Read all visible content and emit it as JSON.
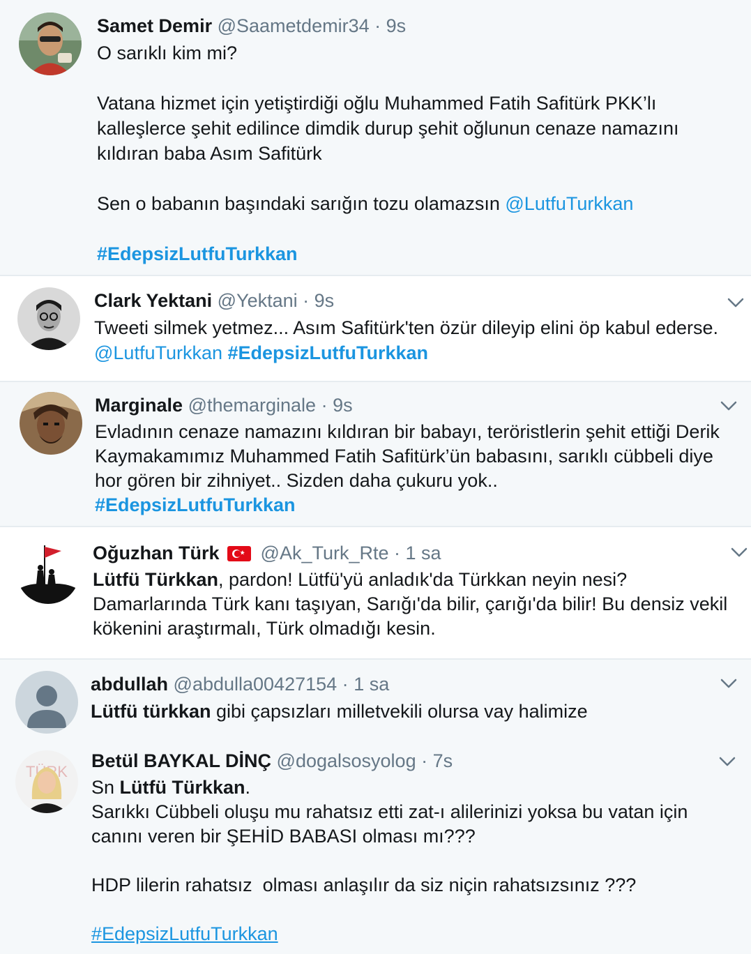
{
  "tweets": [
    {
      "name": "Samet Demir",
      "handle": "@Saametdemir34",
      "time": "9s",
      "line1": "O sarıklı kim mi?",
      "para2": "Vatana hizmet için yetiştirdiği oğlu Muhammed Fatih Safitürk PKK’lı kalleşlerce şehit edilince dimdik durup şehit oğlunun cenaze namazını kıldıran baba Asım Safitürk",
      "para3_text": "Sen o babanın başındaki sarığın tozu olamazsın ",
      "para3_mention": "@LutfuTurkkan",
      "hashtag": "#EdepsizLutfuTurkkan"
    },
    {
      "name": "Clark Yektani",
      "handle": "@Yektani",
      "time": "9s",
      "text": "Tweeti silmek yetmez... Asım Safitürk'ten özür dileyip elini öp kabul ederse.",
      "mention": "@LutfuTurkkan",
      "hashtag": "#EdepsizLutfuTurkkan"
    },
    {
      "name": "Marginale",
      "handle": "@themarginale",
      "time": "9s",
      "text": "Evladının cenaze namazını kıldıran bir babayı, teröristlerin şehit ettiği Derik Kaymakamımız Muhammed Fatih Safitürk’ün babasını, sarıklı cübbeli diye hor gören bir zihniyet.. Sizden daha çukuru yok..",
      "hashtag": "#EdepsizLutfuTurkkan"
    },
    {
      "name": "Oğuzhan Türk",
      "handle": "@Ak_Turk_Rte",
      "time": "1 sa",
      "bold": "Lütfü Türkkan",
      "text": ", pardon! Lütfü'yü anladık'da Türkkan neyin nesi? Damarlarında Türk kanı taşıyan, Sarığı'da bilir, çarığı'da bilir! Bu densiz vekil kökenini araştırmalı, Türk olmadığı kesin."
    },
    {
      "name": "abdullah",
      "handle": "@abdulla00427154",
      "time": "1 sa",
      "bold": "Lütfü türkkan",
      "text": " gibi çapsızları milletvekili olursa vay halimize"
    },
    {
      "name": "Betül BAYKAL DİNÇ",
      "handle": "@dogalsosyolog",
      "time": "7s",
      "line1_prefix": "Sn ",
      "line1_bold": "Lütfü Türkkan",
      "line1_suffix": ".",
      "para2": "Sarıkkı Cübbeli oluşu mu rahatsız etti zat-ı alilerinizi yoksa bu vatan için canını veren bir ŞEHİD BABASI olması mı???",
      "para3": "HDP lilerin rahatsız  olması anlaşılır da siz niçin rahatsızsınız ???",
      "hashtag": "#EdepsizLutfuTurkkan",
      "avatar_text": "TÜRK"
    }
  ],
  "separator": "·",
  "colors": {
    "link": "#1b95e0",
    "muted": "#657786",
    "tint": "#f5f8fa"
  },
  "icons": [
    "chevron-down-icon",
    "turkey-flag-icon"
  ]
}
